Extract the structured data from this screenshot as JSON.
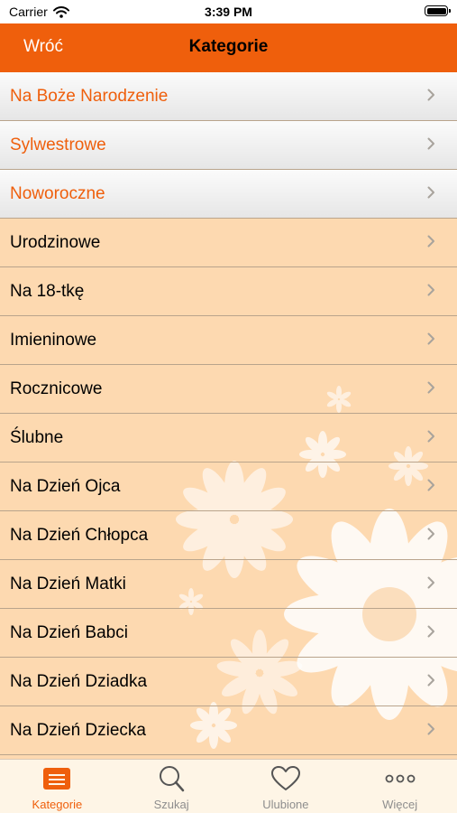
{
  "status": {
    "carrier": "Carrier",
    "time": "3:39 PM"
  },
  "nav": {
    "back_label": "Wróć",
    "title": "Kategorie"
  },
  "featured_categories": [
    {
      "label": "Na Boże Narodzenie"
    },
    {
      "label": "Sylwestrowe"
    },
    {
      "label": "Noworoczne"
    }
  ],
  "categories": [
    {
      "label": "Urodzinowe"
    },
    {
      "label": "Na 18-tkę"
    },
    {
      "label": "Imieninowe"
    },
    {
      "label": "Rocznicowe"
    },
    {
      "label": "Ślubne"
    },
    {
      "label": "Na Dzień Ojca"
    },
    {
      "label": "Na Dzień Chłopca"
    },
    {
      "label": "Na Dzień Matki"
    },
    {
      "label": "Na Dzień Babci"
    },
    {
      "label": "Na Dzień Dziadka"
    },
    {
      "label": "Na Dzień Dziecka"
    }
  ],
  "tabs": [
    {
      "label": "Kategorie",
      "icon": "categories-icon",
      "active": true
    },
    {
      "label": "Szukaj",
      "icon": "search-icon",
      "active": false
    },
    {
      "label": "Ulubione",
      "icon": "heart-icon",
      "active": false
    },
    {
      "label": "Więcej",
      "icon": "more-icon",
      "active": false
    }
  ],
  "colors": {
    "accent": "#ef5f0c",
    "list_background": "#fdd9b0",
    "tab_bar_background": "#fef5e6",
    "inactive_tab": "#8e8e8e"
  }
}
